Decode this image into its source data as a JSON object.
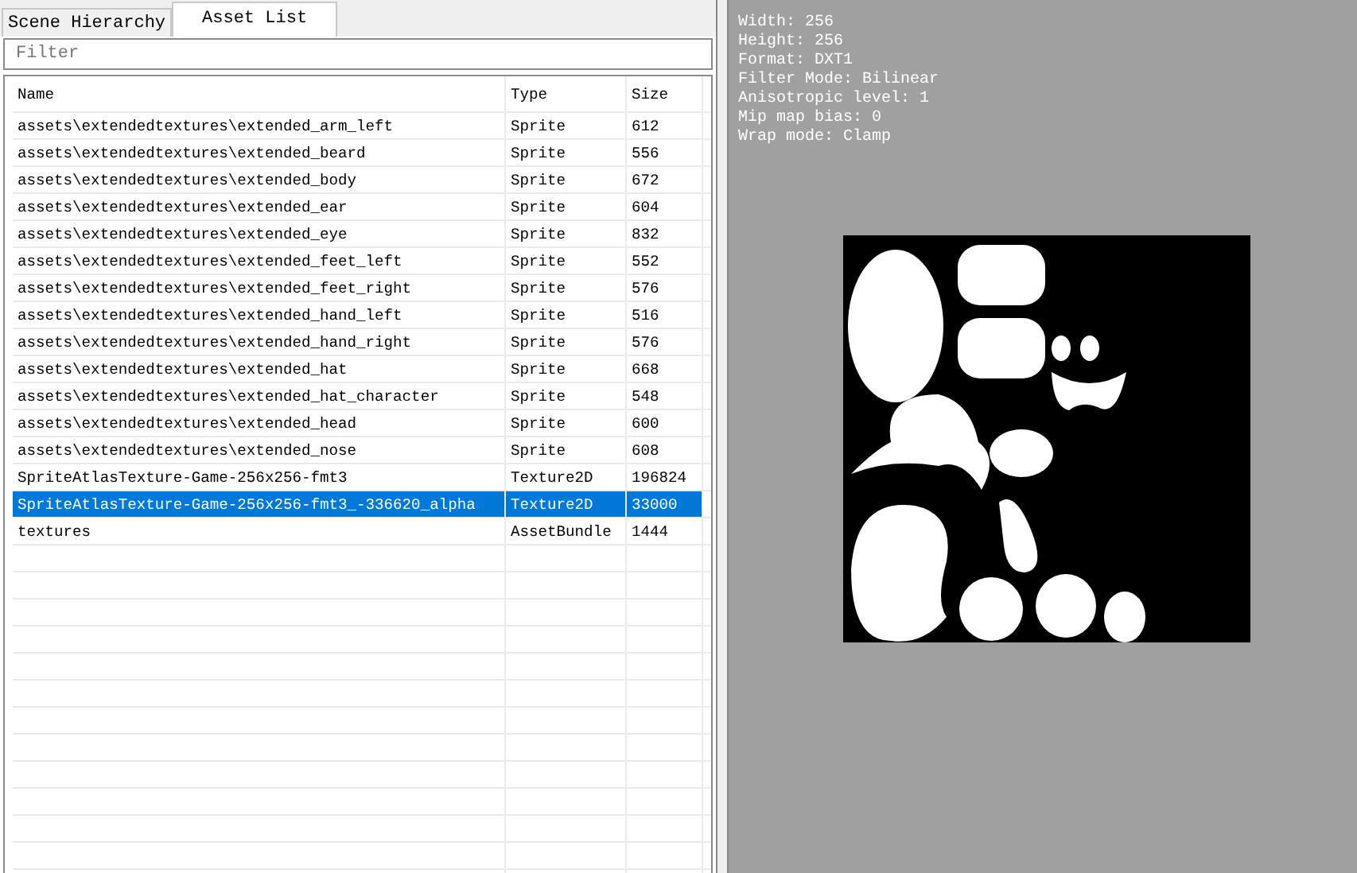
{
  "tabs": [
    {
      "label": "Scene Hierarchy",
      "selected": false
    },
    {
      "label": "Asset List",
      "selected": true
    }
  ],
  "filter": {
    "placeholder": "Filter"
  },
  "table": {
    "columns": [
      "Name",
      "Type",
      "Size"
    ],
    "rows": [
      {
        "name": "assets\\extendedtextures\\extended_arm_left",
        "type": "Sprite",
        "size": "612",
        "selected": false
      },
      {
        "name": "assets\\extendedtextures\\extended_beard",
        "type": "Sprite",
        "size": "556",
        "selected": false
      },
      {
        "name": "assets\\extendedtextures\\extended_body",
        "type": "Sprite",
        "size": "672",
        "selected": false
      },
      {
        "name": "assets\\extendedtextures\\extended_ear",
        "type": "Sprite",
        "size": "604",
        "selected": false
      },
      {
        "name": "assets\\extendedtextures\\extended_eye",
        "type": "Sprite",
        "size": "832",
        "selected": false
      },
      {
        "name": "assets\\extendedtextures\\extended_feet_left",
        "type": "Sprite",
        "size": "552",
        "selected": false
      },
      {
        "name": "assets\\extendedtextures\\extended_feet_right",
        "type": "Sprite",
        "size": "576",
        "selected": false
      },
      {
        "name": "assets\\extendedtextures\\extended_hand_left",
        "type": "Sprite",
        "size": "516",
        "selected": false
      },
      {
        "name": "assets\\extendedtextures\\extended_hand_right",
        "type": "Sprite",
        "size": "576",
        "selected": false
      },
      {
        "name": "assets\\extendedtextures\\extended_hat",
        "type": "Sprite",
        "size": "668",
        "selected": false
      },
      {
        "name": "assets\\extendedtextures\\extended_hat_character",
        "type": "Sprite",
        "size": "548",
        "selected": false
      },
      {
        "name": "assets\\extendedtextures\\extended_head",
        "type": "Sprite",
        "size": "600",
        "selected": false
      },
      {
        "name": "assets\\extendedtextures\\extended_nose",
        "type": "Sprite",
        "size": "608",
        "selected": false
      },
      {
        "name": "SpriteAtlasTexture-Game-256x256-fmt3",
        "type": "Texture2D",
        "size": "196824",
        "selected": false
      },
      {
        "name": "SpriteAtlasTexture-Game-256x256-fmt3_-336620_alpha",
        "type": "Texture2D",
        "size": "33000",
        "selected": true
      },
      {
        "name": "textures",
        "type": "AssetBundle",
        "size": "1444",
        "selected": false
      }
    ]
  },
  "preview": {
    "info": [
      "Width: 256",
      "Height: 256",
      "Format: DXT1",
      "Filter Mode: Bilinear",
      "Anisotropic level: 1",
      "Mip map bias: 0",
      "Wrap mode: Clamp"
    ]
  }
}
